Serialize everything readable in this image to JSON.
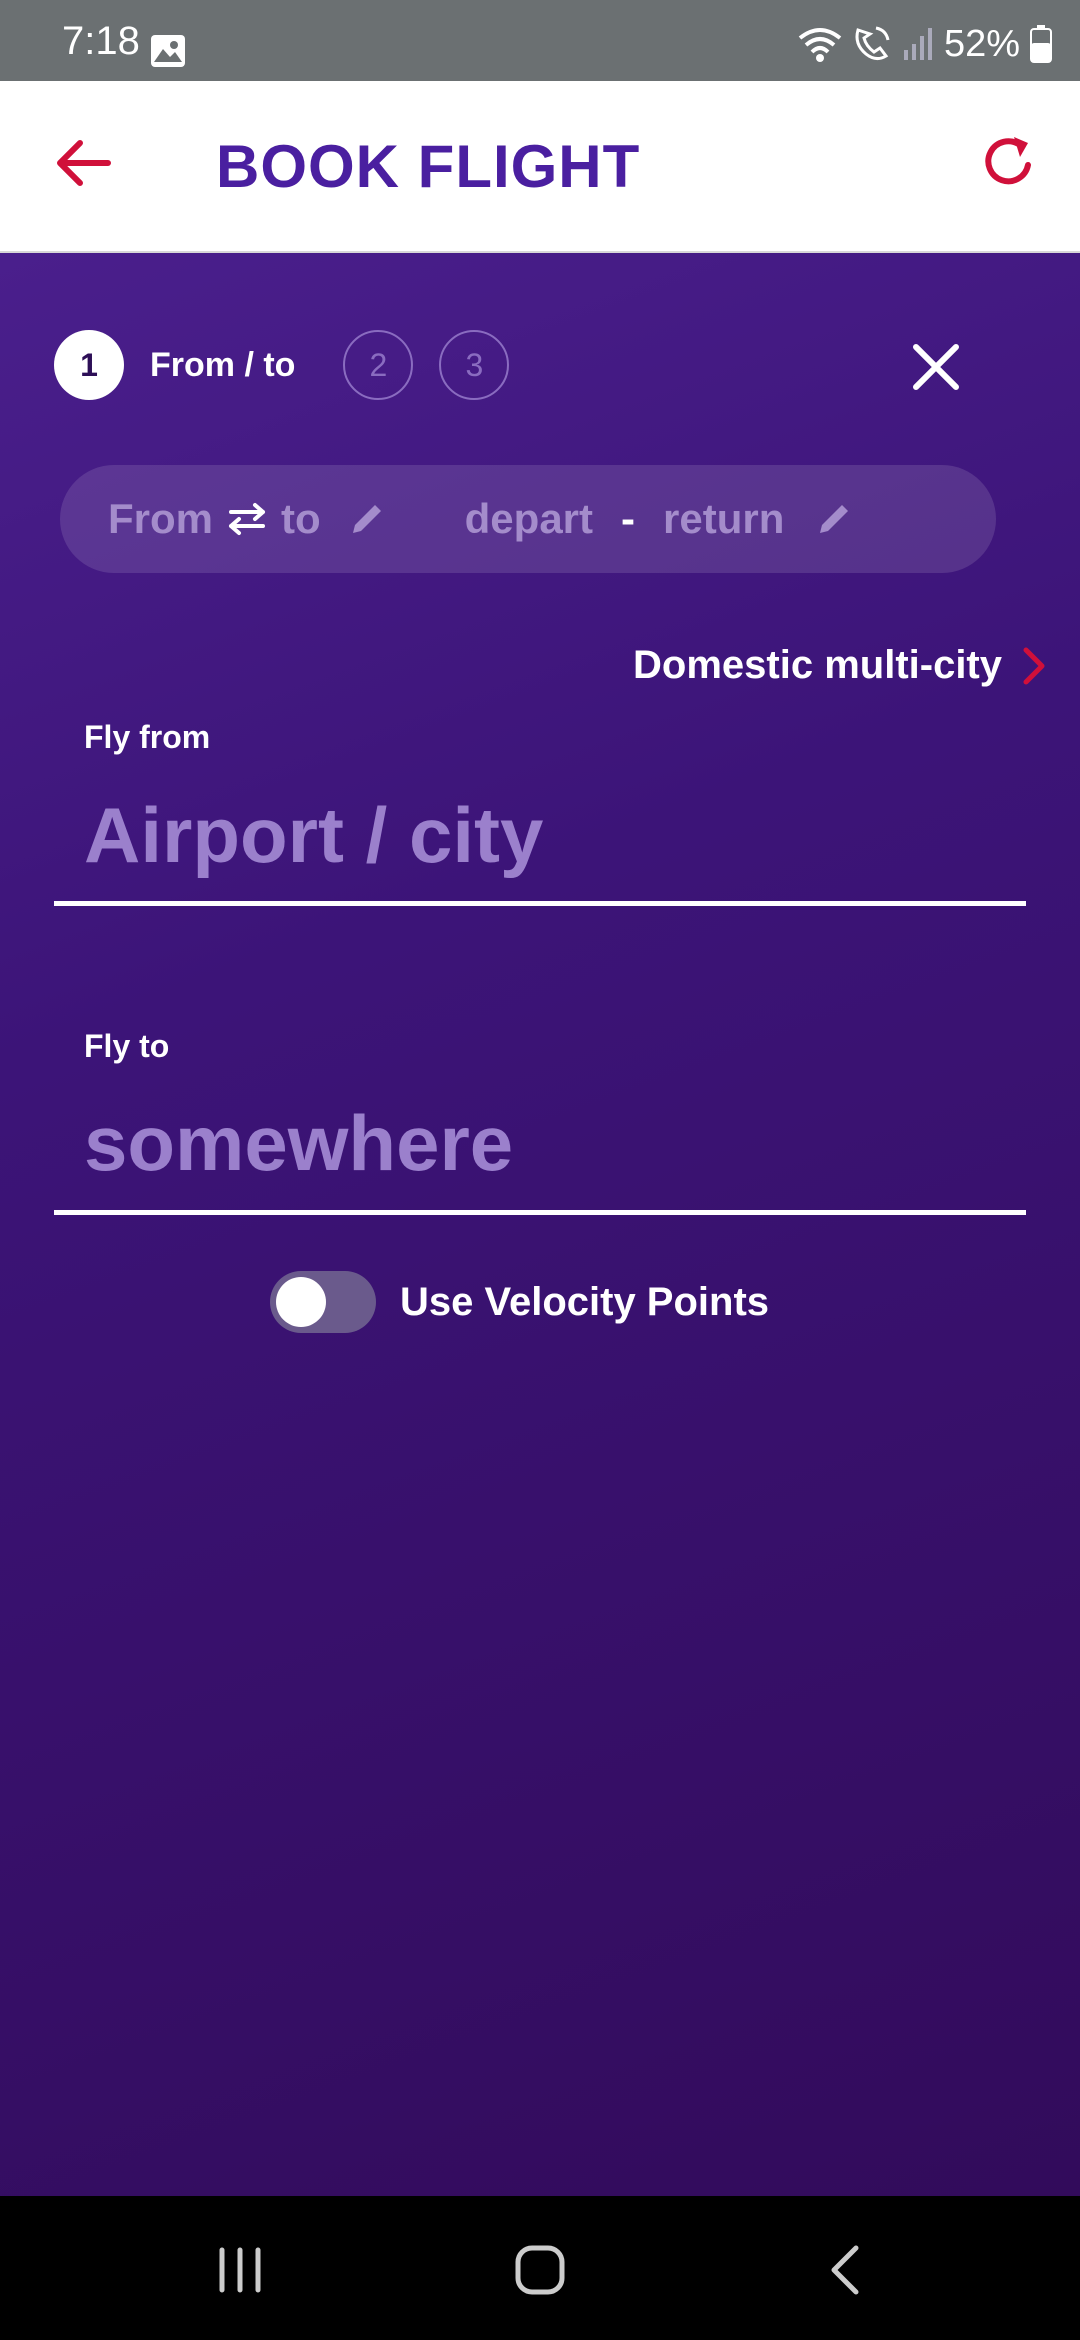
{
  "status_bar": {
    "time": "7:18",
    "battery": "52%",
    "icons": [
      "gallery-icon",
      "wifi-icon",
      "wifi-calling-icon",
      "signal-icon",
      "battery-icon"
    ]
  },
  "header": {
    "title": "BOOK FLIGHT",
    "accent_color": "#d0103a",
    "title_color": "#4a1fa0"
  },
  "stepper": {
    "active_step": "1",
    "active_label": "From / to",
    "steps": [
      "2",
      "3"
    ]
  },
  "summary": {
    "from": "From",
    "to": "to",
    "depart": "depart",
    "dash": "-",
    "return": "return"
  },
  "multicity_link": "Domestic multi-city",
  "fly_from": {
    "label": "Fly from",
    "placeholder": "Airport / city"
  },
  "fly_to": {
    "label": "Fly to",
    "placeholder": "somewhere"
  },
  "velocity_toggle": {
    "label": "Use Velocity Points",
    "checked": false
  },
  "colors": {
    "background": "#3a1570",
    "placeholder": "#9b80cc"
  }
}
